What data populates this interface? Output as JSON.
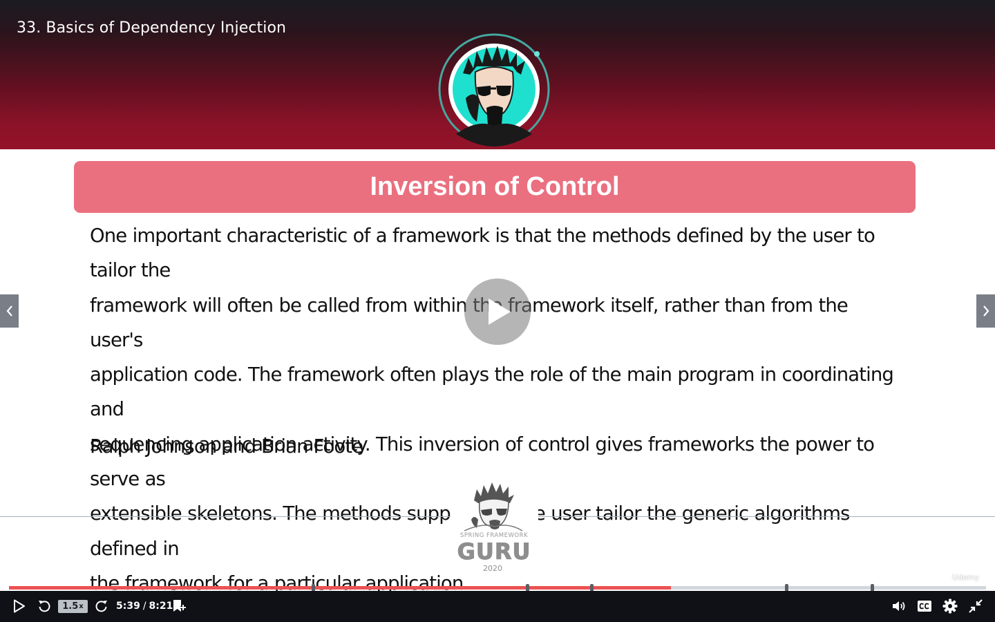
{
  "lecture": {
    "title": "33. Basics of Dependency Injection"
  },
  "slide": {
    "title": "Inversion of Control",
    "quote_lines": [
      "One important characteristic of a framework is that the methods defined by the user to tailor the",
      "framework will often be called from within the framework itself, rather than from the user's",
      "application code. The framework often plays the role of the main program in coordinating and",
      "sequencing application activity. This inversion of control gives frameworks the power to serve as",
      "extensible skeletons. The methods supplied by the user tailor the generic algorithms defined in",
      "the framework for a particular application."
    ],
    "author": "Ralph Johnson and Brian Foote",
    "footer_logo": {
      "caption": "SPRING FRAMEWORK",
      "word": "GURU",
      "year": "2020"
    }
  },
  "watermark": "Udemy",
  "player": {
    "speed_value": "1.5",
    "speed_unit": "x",
    "current_time": "5:39",
    "separator": "/",
    "duration": "8:21",
    "progress_fraction": 0.6774,
    "colors": {
      "progress": "#ec5252",
      "track": "#d1d7dc",
      "bar": "#0f1116",
      "title_pill": "#ea7080"
    },
    "icons": [
      "play-icon",
      "rewind-5-icon",
      "forward-5-icon",
      "add-bookmark-icon",
      "volume-icon",
      "captions-icon",
      "settings-icon",
      "exit-fullscreen-icon"
    ]
  }
}
